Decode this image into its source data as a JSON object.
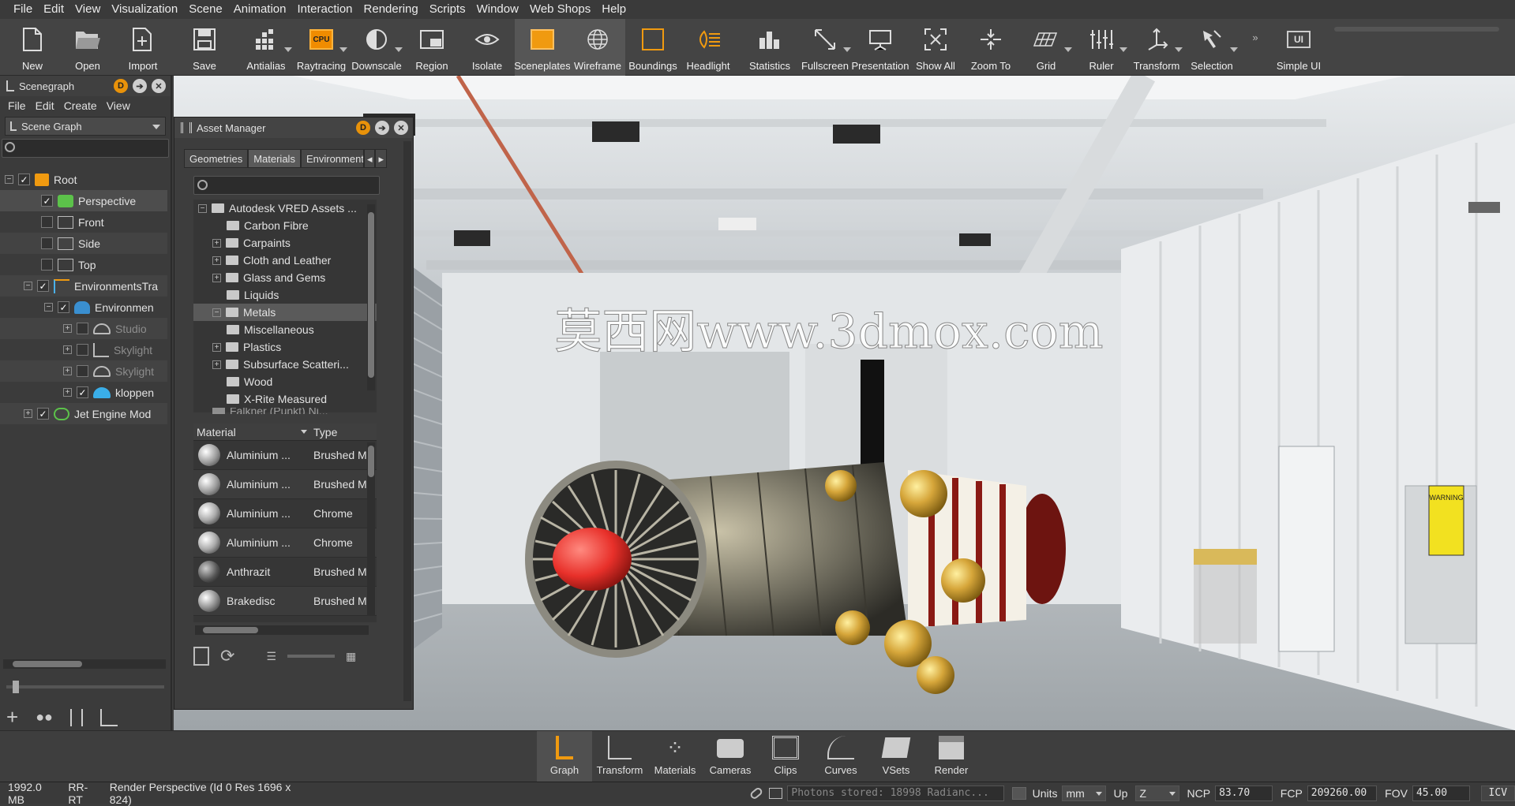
{
  "menu": [
    "File",
    "Edit",
    "View",
    "Visualization",
    "Scene",
    "Animation",
    "Interaction",
    "Rendering",
    "Scripts",
    "Window",
    "Web Shops",
    "Help"
  ],
  "toolbar": [
    {
      "label": "New",
      "icon": "new-file-icon"
    },
    {
      "label": "Open",
      "icon": "folder-open-icon"
    },
    {
      "label": "Import",
      "icon": "import-icon"
    },
    {
      "label": "Save",
      "icon": "save-icon"
    },
    {
      "label": "Antialias",
      "icon": "antialias-icon"
    },
    {
      "label": "Raytracing",
      "icon": "cpu-icon"
    },
    {
      "label": "Downscale",
      "icon": "downscale-icon"
    },
    {
      "label": "Region",
      "icon": "region-icon"
    },
    {
      "label": "Isolate",
      "icon": "eye-icon"
    },
    {
      "label": "Sceneplates",
      "icon": "sceneplate-icon"
    },
    {
      "label": "Wireframe",
      "icon": "wireframe-icon"
    },
    {
      "label": "Boundings",
      "icon": "boundings-icon"
    },
    {
      "label": "Headlight",
      "icon": "headlight-icon"
    },
    {
      "label": "Statistics",
      "icon": "statistics-icon"
    },
    {
      "label": "Fullscreen",
      "icon": "fullscreen-icon"
    },
    {
      "label": "Presentation",
      "icon": "presentation-icon"
    },
    {
      "label": "Show All",
      "icon": "show-all-icon"
    },
    {
      "label": "Zoom To",
      "icon": "zoom-to-icon"
    },
    {
      "label": "Grid",
      "icon": "grid-icon"
    },
    {
      "label": "Ruler",
      "icon": "ruler-icon"
    },
    {
      "label": "Transform",
      "icon": "transform-icon"
    },
    {
      "label": "Selection",
      "icon": "selection-icon"
    },
    {
      "label": "Simple UI",
      "icon": "simple-ui-icon"
    }
  ],
  "cpu_badge": "CPU",
  "ui_badge": "UI",
  "scenegraph": {
    "title": "Scenegraph",
    "d_badge": "D",
    "menu": [
      "File",
      "Edit",
      "Create",
      "View"
    ],
    "combo": "Scene Graph",
    "nodes": [
      {
        "label": "Root"
      },
      {
        "label": "Perspective"
      },
      {
        "label": "Front"
      },
      {
        "label": "Side"
      },
      {
        "label": "Top"
      },
      {
        "label": "EnvironmentsTra"
      },
      {
        "label": "Environmen"
      },
      {
        "label": "Studio"
      },
      {
        "label": "Skylight"
      },
      {
        "label": "Skylight"
      },
      {
        "label": "kloppen"
      },
      {
        "label": "Jet Engine Mod"
      }
    ]
  },
  "asset_manager": {
    "title": "Asset Manager",
    "d_badge": "D",
    "tabs": [
      "Geometries",
      "Materials",
      "Environments"
    ],
    "folders": [
      "Autodesk VRED Assets ...",
      "Carbon Fibre",
      "Carpaints",
      "Cloth and Leather",
      "Glass and Gems",
      "Liquids",
      "Metals",
      "Miscellaneous",
      "Plastics",
      "Subsurface Scatteri...",
      "Wood",
      "X-Rite Measured",
      "Falkner (Punkt) Ni..."
    ],
    "list_headers": {
      "material": "Material",
      "type": "Type"
    },
    "materials": [
      {
        "name": "Aluminium ...",
        "type": "Brushed M"
      },
      {
        "name": "Aluminium ...",
        "type": "Brushed M"
      },
      {
        "name": "Aluminium ...",
        "type": "Chrome"
      },
      {
        "name": "Aluminium ...",
        "type": "Chrome"
      },
      {
        "name": "Anthrazit",
        "type": "Brushed M"
      },
      {
        "name": "Brakedisc",
        "type": "Brushed M"
      }
    ]
  },
  "watermark": "莫西网www.3dmox.com",
  "warning_sign": "WARNING",
  "dock": [
    {
      "label": "Graph",
      "icon": "graph-icon"
    },
    {
      "label": "Transform",
      "icon": "transform-icon"
    },
    {
      "label": "Materials",
      "icon": "materials-icon"
    },
    {
      "label": "Cameras",
      "icon": "camera-icon"
    },
    {
      "label": "Clips",
      "icon": "clips-icon"
    },
    {
      "label": "Curves",
      "icon": "curves-icon"
    },
    {
      "label": "VSets",
      "icon": "vsets-icon"
    },
    {
      "label": "Render",
      "icon": "render-icon"
    }
  ],
  "status": {
    "memory": "1992.0 MB",
    "mode": "RR-RT",
    "render_info": "Render Perspective (Id 0 Res 1696 x 824)",
    "photons": "Photons stored: 18998 Radianc...",
    "units_label": "Units",
    "units_value": "mm",
    "up_label": "Up",
    "up_value": "Z",
    "ncp_label": "NCP",
    "ncp_value": "83.70",
    "fcp_label": "FCP",
    "fcp_value": "209260.00",
    "fov_label": "FOV",
    "fov_value": "45.00",
    "icv": "ICV"
  }
}
